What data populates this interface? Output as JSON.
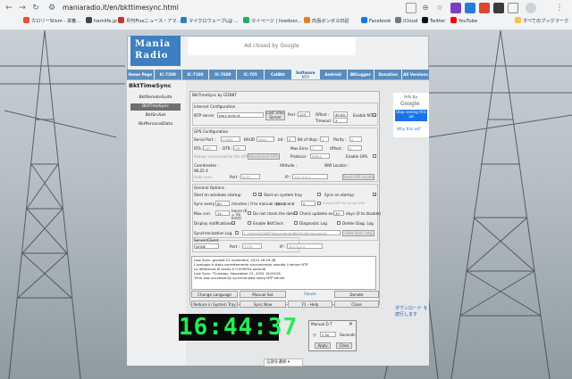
{
  "browser": {
    "url": "maniaradio.it/en/bkttimesync.html",
    "bookmarks": [
      "カロリーSlism - 栄養...",
      "hamlife.jp",
      "月刊Fiveニュース・アマ...",
      "マイクロウェーブL@ ...",
      "マイページ | livedoor...",
      "向島ボンボヨ日記",
      "Facebook",
      "iCloud",
      "Twitter",
      "YouTube"
    ],
    "all_bookmarks": "すべてのブックマーク"
  },
  "site": {
    "logo_line1": "Mania",
    "logo_line2": "Radio",
    "ad_closed": "Ad closed by Google",
    "tabs": [
      "Home Page",
      "IC-7300",
      "IC-7100",
      "IC-7600",
      "IC-705",
      "CatBkt",
      "Software",
      "Android",
      "BKLogger",
      "Donation",
      "All Versions"
    ],
    "software_sub": "NTP",
    "side_title": "BktTimeSync",
    "side_items": [
      "BktRemoteSuite",
      "BktTimeSync",
      "BktSrvSet",
      "BktPersonalData"
    ]
  },
  "app": {
    "title": "BktTimeSync by IZ2BKT",
    "internet_title": "Internet Configuration",
    "ntp_server_label": "NTP server",
    "ntp_server": "ntp1.inrim.it",
    "last_time_server": "Last Time Server",
    "port_label": "Port :",
    "port": "123",
    "offset_label": "Offset :",
    "offset": "40.00",
    "timeout_label": "Timeout :",
    "timeout": "3",
    "enable_ntp": "Enable NTP",
    "gps_title": "GPS Configuration",
    "serial_port": "Serial Port :",
    "serial_val": "COM3",
    "baud": "BAUD :",
    "baud_val": "4800",
    "bit": "bit :",
    "bit_val": "8",
    "bit_stop": "Bit of Stop :",
    "bit_stop_val": "1",
    "parity": "Parity :",
    "parity_val": "0",
    "rts": "RTS :",
    "rts_val": "OFF",
    "dtr": "DTR :",
    "dtr_val": "ON",
    "max_error": "Max Error :",
    "max_error_val": "7",
    "gps_offset": "Offset :",
    "gps_offset_val": "0",
    "always_connected": "Always connected to the GPS",
    "disconnect_gps": "Disconnect GPS",
    "protocol": "Protocol :",
    "protocol_val": "NMEA",
    "enable_gps": "Enable GPS",
    "coordinates": "Coordinates :",
    "altitude": "Altitude :",
    "wwl": "WW Locator :",
    "wl25": "WL25 4",
    "auto_sync": "Auto sync",
    "port2": "Port :",
    "port2_val": "2237",
    "ip": "IP :",
    "ip_val": "127.0.0.1",
    "send_gps": "Send GPS Locator",
    "general_title": "General Options",
    "start_windows": "Start on windows startup",
    "start_tray": "Start on system tray",
    "sync_startup": "Sync on startup",
    "sync_every": "Sync every",
    "sync_every_val": "60",
    "sync_every_unit": "minutes ( 0 to manual sync )",
    "to_second": "to second",
    "to_second_val": "0",
    "error_ntp": "If error NTP try to use GPS",
    "max_corr": "Max corr.",
    "max_corr_val": "12",
    "hours": "hours (0 = no limit)",
    "no_check": "Do not check the date",
    "check_updates": "Check updates every",
    "check_val": "30",
    "days": "days (0 to disable)",
    "display_notif": "Display notifications",
    "enable_bkt": "Enable BktClock",
    "diag_log": "Diagnostic Log",
    "delete_diag": "Delete Diag. Log",
    "sync_log": "Synchronization Log",
    "log_path": "C:\\Users\\IZ2BKT\\Documents\\BktTimeSyncLog.txt",
    "view_sync": "View Sync. Log",
    "server_client": "Server/Client",
    "server_val": "NONE",
    "port3": "Port :",
    "port3_val": "7070",
    "ip3": "IP :",
    "ip3_val": "127.0.0.1",
    "log_lines": [
      "Last Sync: giovedì 21 novembre, 2024 16:29:48",
      "L'orologio è stato correttamente sincronizzato usando il server NTP",
      "La differenza di orario è 0.009934 secondi",
      "Last Sync: Thursday, November 21, 2024 16:29:05",
      "Time was successfully synchronized using NTP server"
    ],
    "buttons": [
      "Change Language",
      "Manual Set",
      "Forum",
      "Donate",
      "Reduce in System Tray",
      "Sync Now",
      "F1 - Help",
      "Close"
    ]
  },
  "clock": {
    "time": "16:44:37"
  },
  "manual_dt": {
    "title": "Manual D.T",
    "value": "2.50",
    "unit": "Seconds",
    "apply": "Apply",
    "close": "Close"
  },
  "google_ad": {
    "ads_by": "Ads by",
    "google": "Google",
    "stop": "Stop seeing this ad",
    "why": "Why this ad?"
  },
  "download": "ダウンロード を続行します",
  "translate": "言語を選択"
}
